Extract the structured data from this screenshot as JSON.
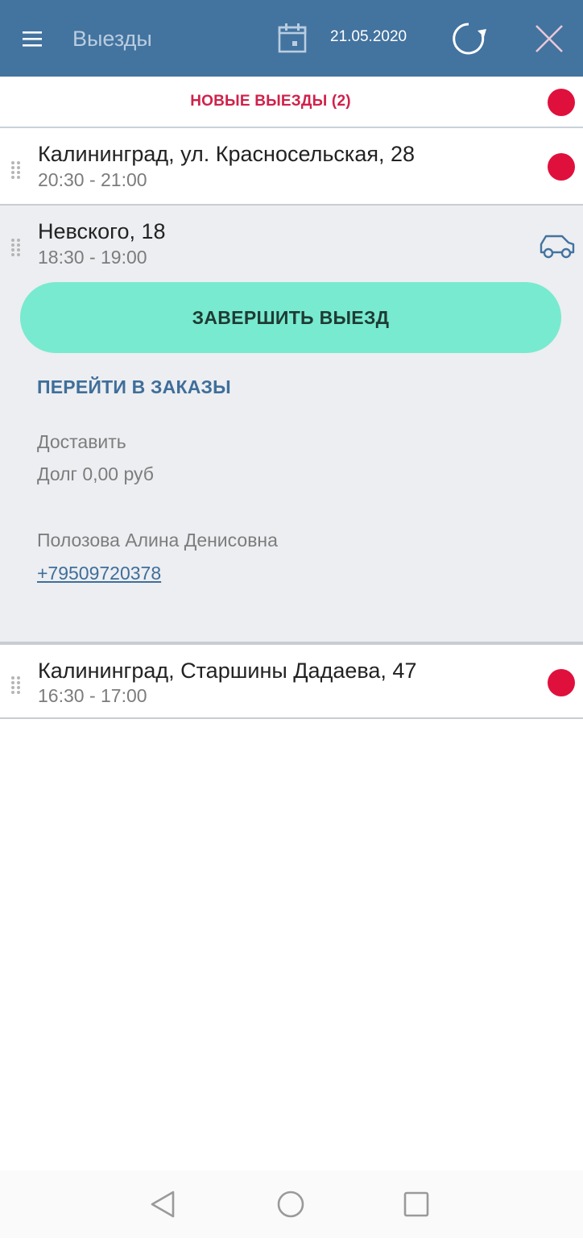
{
  "appbar": {
    "title": "Выезды",
    "date": "21.05.2020",
    "icons": [
      "menu-icon",
      "calendar-icon",
      "refresh-icon",
      "close-icon"
    ],
    "background": "#43739f"
  },
  "new_visits": {
    "label": "НОВЫЕ ВЫЕЗДЫ (2)",
    "color": "#d0214a"
  },
  "visits": [
    {
      "address": "Калининград, ул. Красносельская, 28",
      "time": "20:30 - 21:00",
      "status": "new"
    },
    {
      "address": "Невского, 18",
      "time": "18:30 - 19:00",
      "status": "in-progress",
      "finish_label": "ЗАВЕРШИТЬ ВЫЕЗД",
      "orders_link": "ПЕРЕЙТИ В ЗАКАЗЫ",
      "action": "Доставить",
      "debt": "Долг 0,00 руб",
      "client": "Полозова Алина Денисовна",
      "phone": "+79509720378"
    },
    {
      "address": "Калининград, Старшины Дадаева, 47",
      "time": "16:30 - 17:00",
      "status": "new"
    }
  ],
  "colors": {
    "new_dot": "#e0103d",
    "finish_button": "#78eacf",
    "link": "#3f6e9a",
    "expanded_bg": "#eceef1"
  }
}
